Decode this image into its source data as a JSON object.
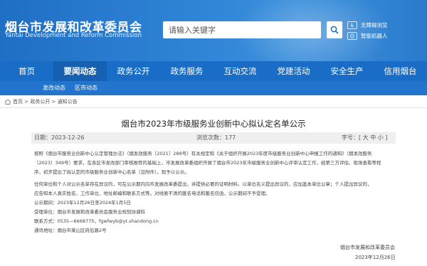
{
  "header": {
    "site_title": "烟台市发展和改革委员会",
    "site_subtitle": "Yantai Development and Reform Commission",
    "search_placeholder": "请输入关键字",
    "side_links": [
      "无障碍浏览",
      "智能机器人"
    ],
    "bg_color": "#2a7bcd"
  },
  "nav": {
    "items": [
      "首页",
      "要闻动态",
      "政务公开",
      "政务服务",
      "互动交流",
      "党建活动",
      "安全生产",
      "信用烟台"
    ],
    "active": "要闻动态",
    "color": "#1a6dc7"
  },
  "subnav": {
    "items": [
      "发改动态",
      "区市动态"
    ]
  },
  "breadcrumb": {
    "items": [
      "首页",
      "政务公开",
      "通知公告"
    ],
    "separator": " > "
  },
  "article": {
    "title": "烟台市2023年市级服务业创新中心拟认定名单公示",
    "date_label": "日期：2023-12-26",
    "views_label": "浏览次数：177",
    "fontsize_label": "字号：[ 大 中 小 ]",
    "paragraphs": [
      "按照《烟台市服务业创新中心认定管理办法》（烟发改服务〔2021〕288号）有关规定和《关于组织开展2023年度市级服务业创新中心申报工作的通知》（烟发改服务",
      "〔2023〕349号）要求，在各区市发改部门审核推荐的基础上，市发展改革委组织开展了烟台市2023年市级服务业创新中心评审认定工作，经第三方评估、现场查看等程",
      "序，初步提出了拟认定的市级服务业创新中心名单（见附件），现予以公示。",
      "任何单位和个人对公示名单存在异议的，可在公示期内向市发展改革委提出，并提供必要的证明材料。以单位名义提出异议的，应加盖本单位公章；个人提出异议的，",
      "应告知本人真实姓名、工作单位、地址邮编和联系方式等。对线索不清的匿名电话和匿名信函，公示期间不予受理。",
      "公示期间：2023年12月26日至2024年1月5日",
      "受理单位：烟台市发展和改革委员会服务业规划协调科",
      "联系方式：0535—6668775，fgwfwyb@yt.shandong.cn",
      "通讯地址：烟台市莱山区府后路2号"
    ],
    "signature_org": "烟台市发展和改革委员会",
    "signature_date": "2023年12月26日"
  }
}
